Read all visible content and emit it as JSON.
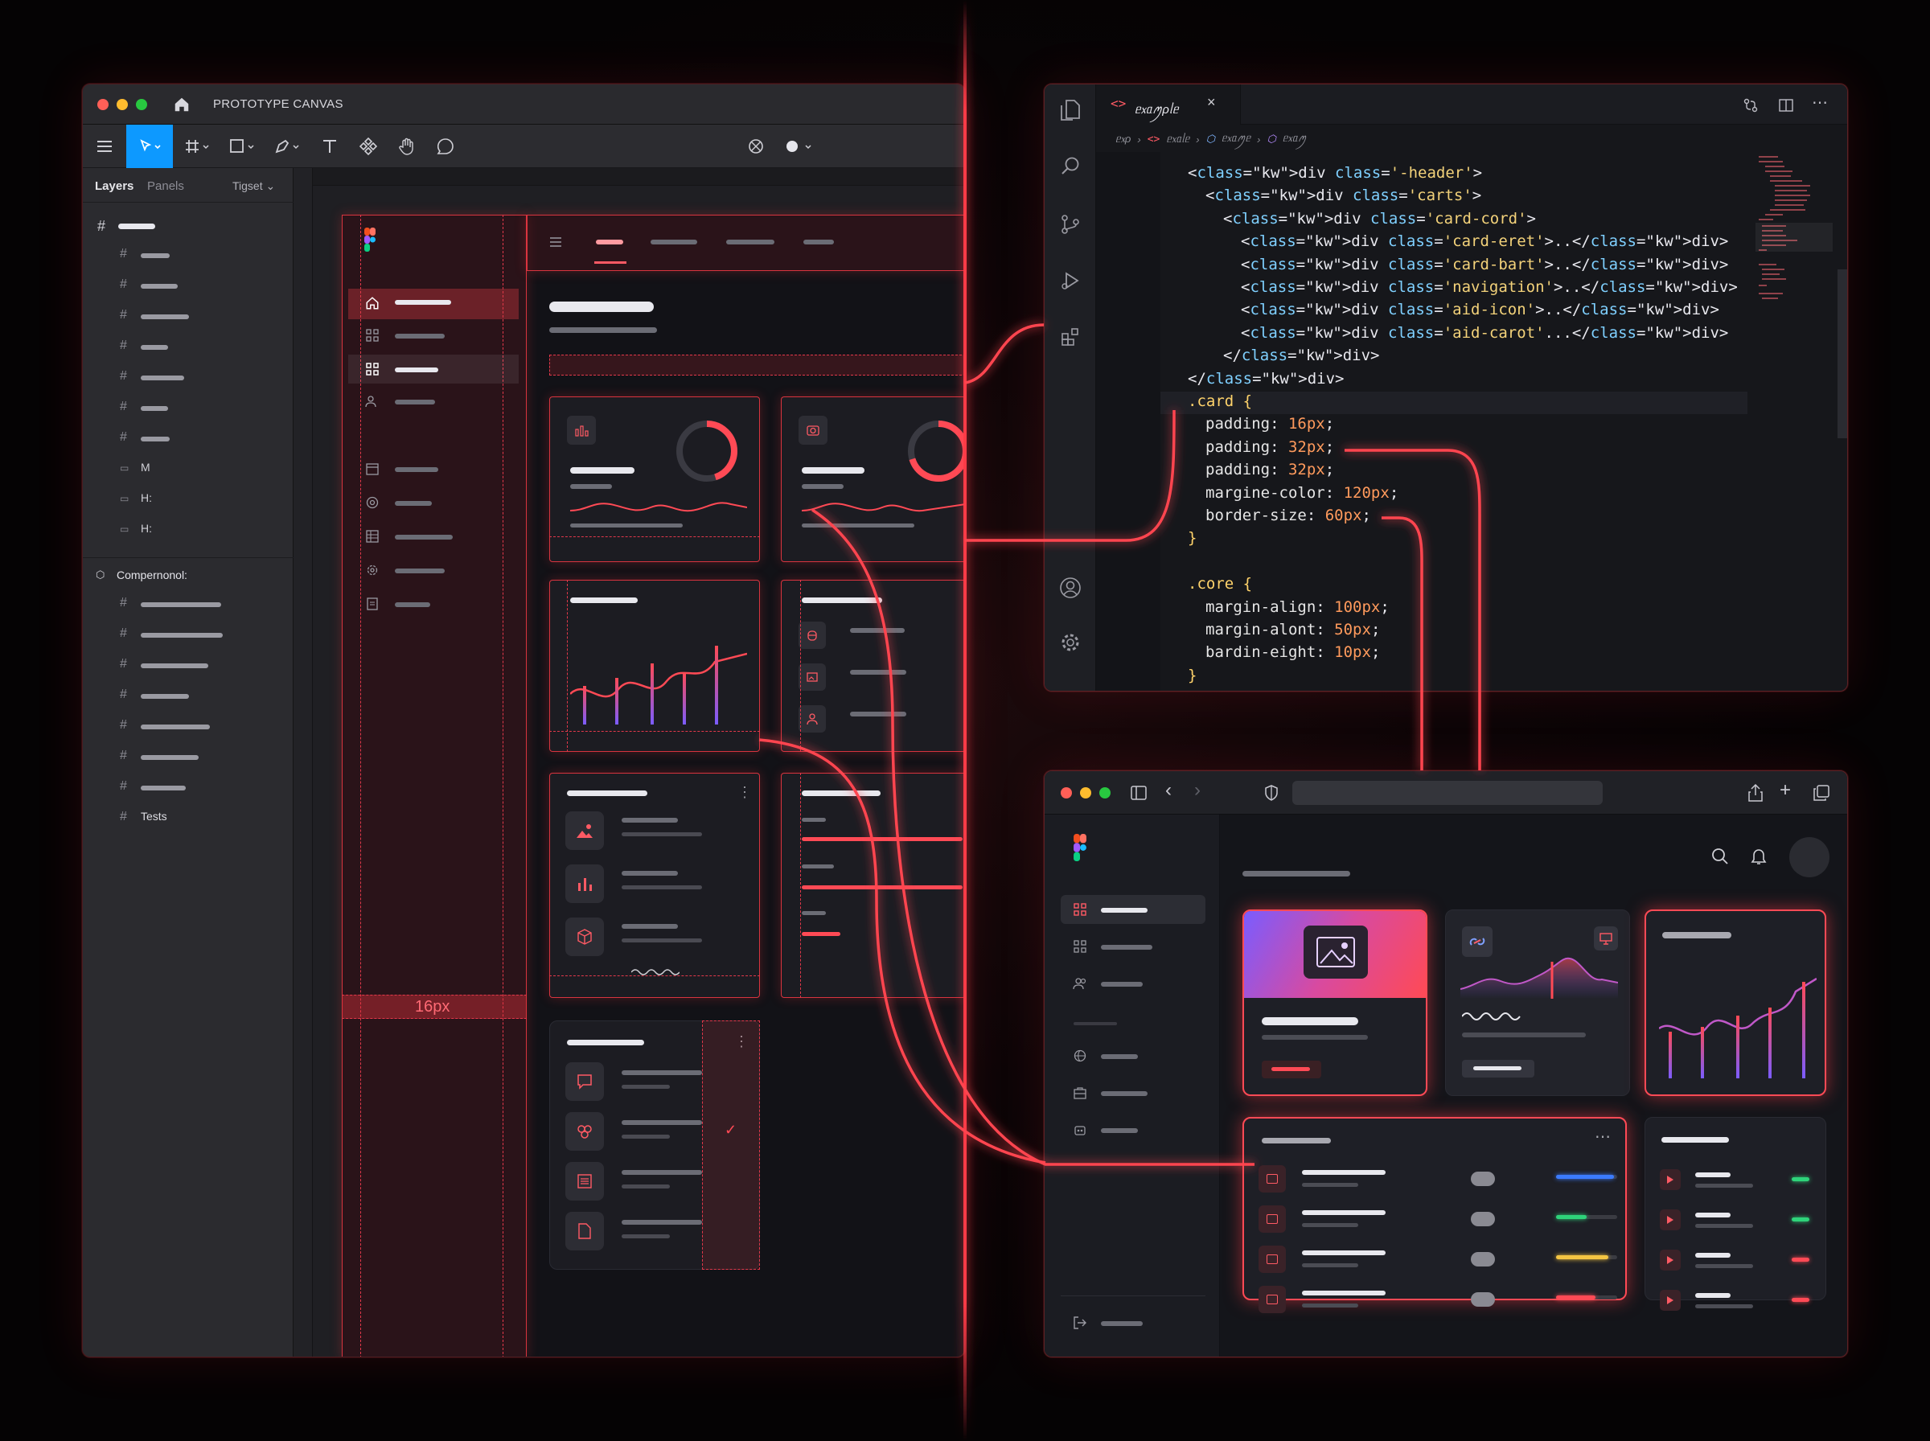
{
  "figma": {
    "tab_title": "PROTOTYPE CANVAS",
    "left_tabs": [
      "Layers",
      "Panels"
    ],
    "tigset": "Tigset",
    "layer_labels": [
      "M",
      "H:",
      "H:"
    ],
    "components_label": "Compernonol:",
    "tests_label": "Tests",
    "spacing_label": "16px"
  },
  "editor": {
    "tab_title": "ᥱ᥊ᥲꪑρᥣᥱ",
    "breadcrumb": [
      "ᥱ᥊ρ",
      "ᥱ᥊ᥲᥣᥱ",
      "ᥱ᥊ᥲꪑᥱ",
      "ᥱ᥊ᥲꪑ"
    ],
    "code": [
      {
        "indent": 0,
        "text": "<div class='-header'>"
      },
      {
        "indent": 1,
        "text": "<div class='carts'>"
      },
      {
        "indent": 2,
        "text": "<div class='card-cord'>"
      },
      {
        "indent": 3,
        "text": "<div class='card-eret'>..</div>"
      },
      {
        "indent": 3,
        "text": "<div class='card-bart'>..</div>"
      },
      {
        "indent": 3,
        "text": "<div class='navigation'>..</div>"
      },
      {
        "indent": 3,
        "text": "<div class='aid-icon'>..</div>"
      },
      {
        "indent": 3,
        "text": "<div class='aid-carot'...</div>"
      },
      {
        "indent": 2,
        "text": "</div>"
      },
      {
        "indent": 0,
        "text": "</div>"
      },
      {
        "indent": 0,
        "text": ".card {"
      },
      {
        "indent": 1,
        "text": "padding: 16px;"
      },
      {
        "indent": 1,
        "text": "padding: 32px;"
      },
      {
        "indent": 1,
        "text": "padding: 32px;"
      },
      {
        "indent": 1,
        "text": "margine-color: 120px;"
      },
      {
        "indent": 1,
        "text": "border-size: 60px;"
      },
      {
        "indent": 0,
        "text": "}"
      },
      {
        "indent": 0,
        "text": ""
      },
      {
        "indent": 0,
        "text": ".core {"
      },
      {
        "indent": 1,
        "text": "margin-align: 100px;"
      },
      {
        "indent": 1,
        "text": "margin-alont: 50px;"
      },
      {
        "indent": 1,
        "text": "bardin-eight: 10px;"
      },
      {
        "indent": 0,
        "text": "}"
      }
    ]
  },
  "colors": {
    "accent": "#ff3b47",
    "blue_bar": "#3b7bff",
    "green_bar": "#2ed37a",
    "yellow_bar": "#f4c542",
    "red_bar": "#ff4a55"
  },
  "browser": {
    "progress_rows": [
      0.95,
      0.5,
      0.85,
      0.65
    ],
    "status_colors": [
      "green",
      "green",
      "red",
      "red"
    ]
  }
}
